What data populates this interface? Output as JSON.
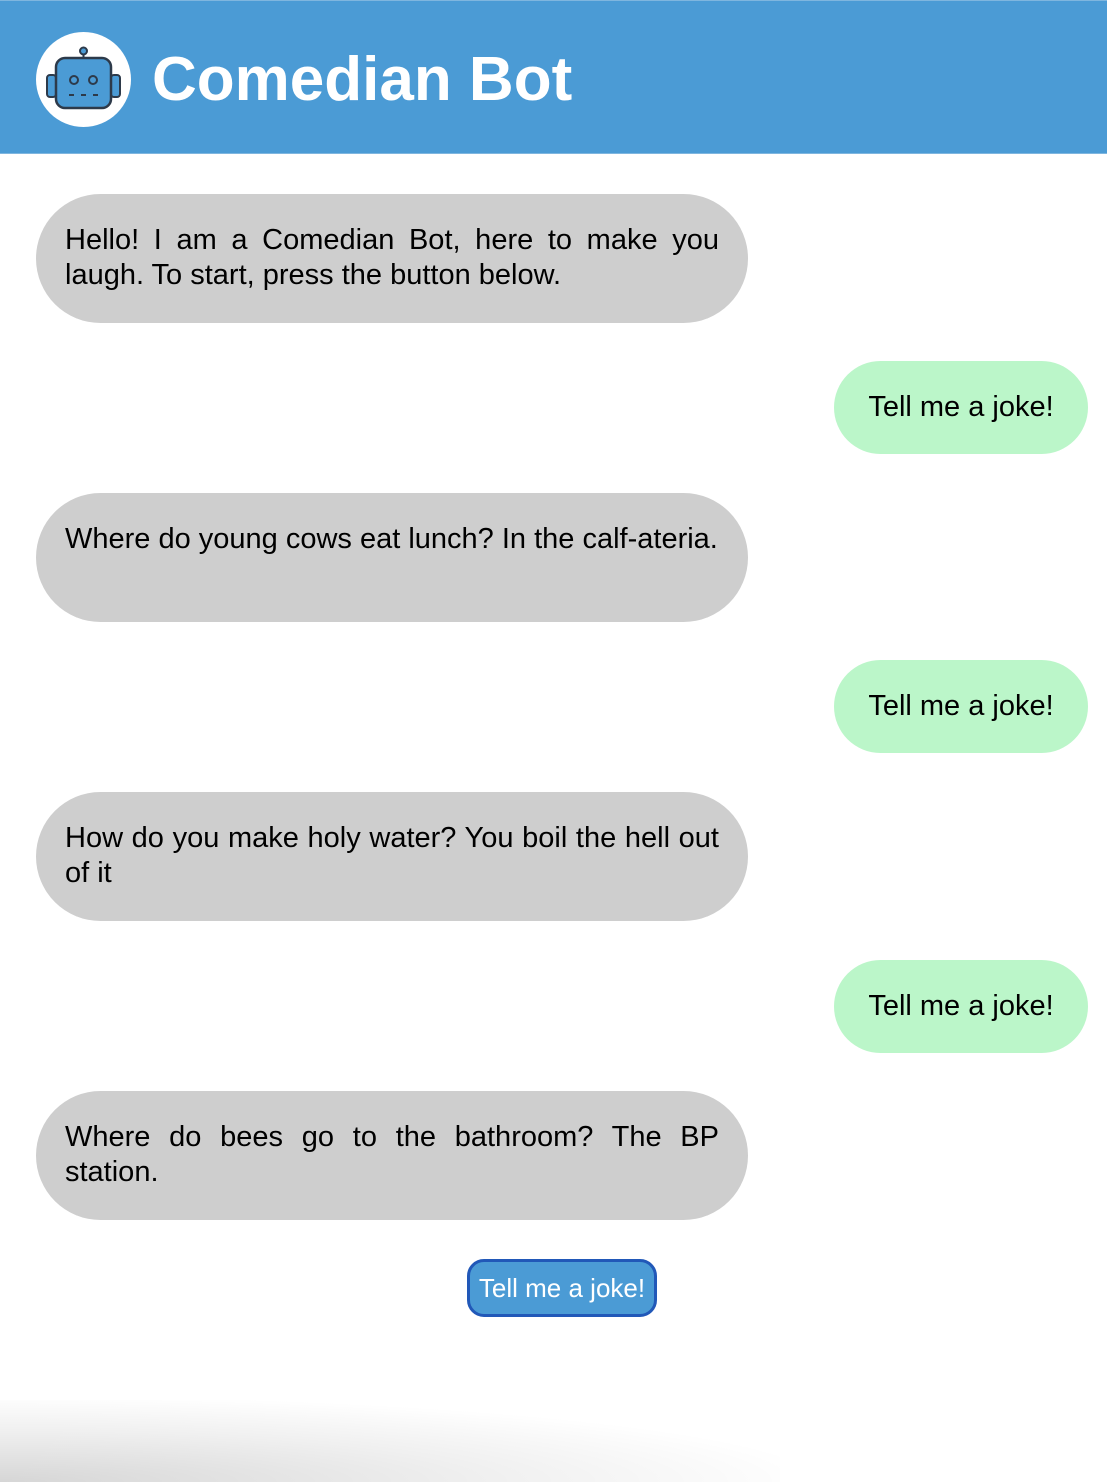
{
  "header": {
    "title": "Comedian Bot",
    "avatar_icon": "robot-icon",
    "background_color": "#4b9bd5"
  },
  "messages": [
    {
      "sender": "bot",
      "text": "Hello! I am a Comedian Bot, here to make you laugh. To start, press the button below."
    },
    {
      "sender": "user",
      "text": "Tell me a joke!"
    },
    {
      "sender": "bot",
      "text": "Where do young cows eat lunch? In the calf-ateria."
    },
    {
      "sender": "user",
      "text": "Tell me a joke!"
    },
    {
      "sender": "bot",
      "text": "How do you make holy water? You boil the hell out of it"
    },
    {
      "sender": "user",
      "text": "Tell me a joke!"
    },
    {
      "sender": "bot",
      "text": "Where do bees go to the bathroom? The BP station."
    }
  ],
  "joke_button": {
    "label": "Tell me a joke!"
  },
  "colors": {
    "bot_bubble": "#cecece",
    "user_bubble": "#bbf6c9",
    "button": "#4b9bd5",
    "button_border": "#2158b8"
  }
}
